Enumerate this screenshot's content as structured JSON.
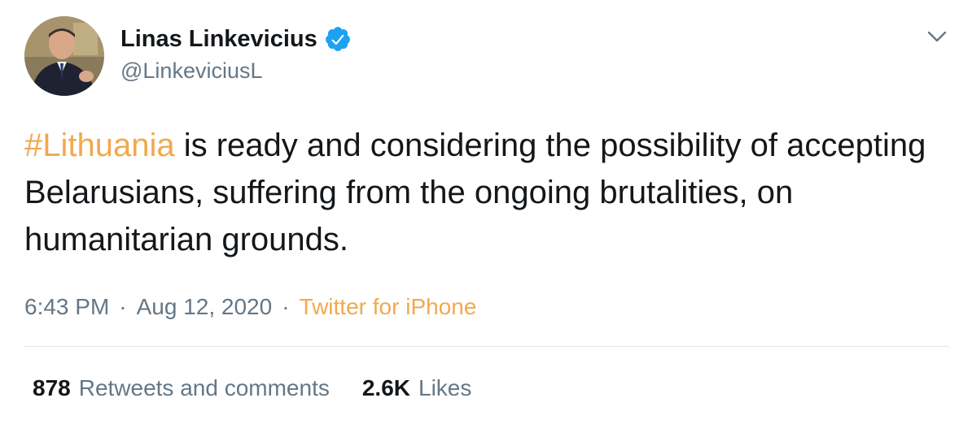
{
  "user": {
    "display_name": "Linas Linkevicius",
    "handle": "@LinkeviciusL",
    "verified": true
  },
  "icons": {
    "verified": "verified-badge-icon",
    "menu": "chevron-down-icon",
    "avatar": "avatar"
  },
  "tweet": {
    "hashtag": "#Lithuania",
    "text": " is ready and considering the possibility of accepting Belarusians, suffering from the ongoing brutalities, on humanitarian grounds."
  },
  "meta": {
    "time": "6:43 PM",
    "separator": "·",
    "date": "Aug 12, 2020",
    "source": "Twitter for iPhone"
  },
  "stats": {
    "retweets_count": "878",
    "retweets_label": "Retweets and comments",
    "likes_count": "2.6K",
    "likes_label": "Likes"
  },
  "colors": {
    "accent": "#f1a94e",
    "verified": "#1da1f2",
    "secondary_text": "#657786",
    "primary_text": "#14171a",
    "divider": "#e1e8ed"
  }
}
